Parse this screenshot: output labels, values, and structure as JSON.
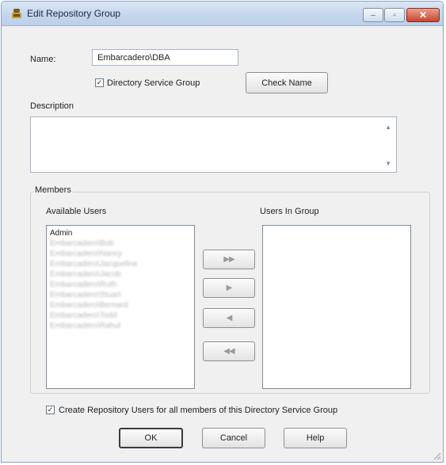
{
  "window": {
    "title": "Edit Repository Group",
    "icon": "repository-group-icon",
    "controls": {
      "minimize": "–",
      "maximize": "▫",
      "close": "✕"
    }
  },
  "name_field": {
    "label": "Name:",
    "value": "Embarcadero\\DBA"
  },
  "directory_service_group": {
    "label": "Directory Service Group",
    "checked": true,
    "mark": "✓"
  },
  "check_name_button": "Check Name",
  "description": {
    "label": "Description",
    "value": "",
    "scroll_up": "▲",
    "scroll_down": "▼"
  },
  "members": {
    "group_label": "Members",
    "available_users": {
      "label": "Available Users",
      "items": [
        {
          "text": "Admin",
          "blurred": false
        },
        {
          "text": "Embarcadero\\Bob",
          "blurred": true
        },
        {
          "text": "Embarcadero\\Nancy",
          "blurred": true
        },
        {
          "text": "Embarcadero\\Jacqueline",
          "blurred": true
        },
        {
          "text": "Embarcadero\\Jacob",
          "blurred": true
        },
        {
          "text": "Embarcadero\\Ruth",
          "blurred": true
        },
        {
          "text": "Embarcadero\\Stuart",
          "blurred": true
        },
        {
          "text": "Embarcadero\\Bernard",
          "blurred": true
        },
        {
          "text": "Embarcadero\\Todd",
          "blurred": true
        },
        {
          "text": "Embarcadero\\Rahul",
          "blurred": true
        }
      ]
    },
    "users_in_group": {
      "label": "Users In Group",
      "items": []
    },
    "transfer_buttons": {
      "add_all": "▶▶",
      "add_one": "▶",
      "remove_one": "◀",
      "remove_all": "◀◀"
    }
  },
  "create_repository_users": {
    "label": "Create Repository Users for all members of this Directory Service Group",
    "checked": true,
    "mark": "✓"
  },
  "buttons": {
    "ok": "OK",
    "cancel": "Cancel",
    "help": "Help"
  },
  "colors": {
    "titlebar": "#c3d5ec",
    "close_button": "#c9452c",
    "dialog_bg": "#f0f0f0"
  }
}
